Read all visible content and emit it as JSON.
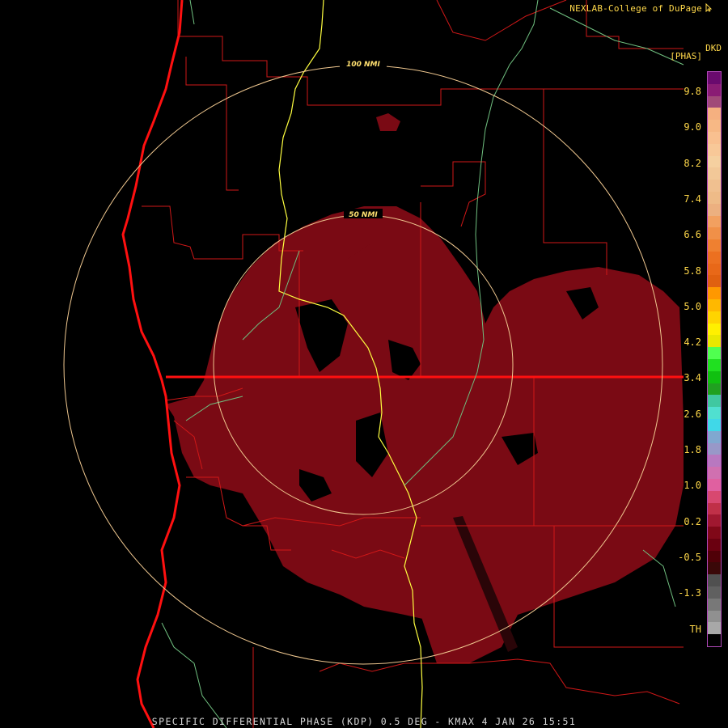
{
  "credit": "NEXLAB-College of DuPage",
  "product_code": "DKD",
  "units": "[PHAS]",
  "footer": "SPECIFIC DIFFERENTIAL PHASE (KDP) 0.5 DEG - KMAX 4 JAN 26 15:51",
  "range_rings": [
    "100 NMI",
    "50 NMI"
  ],
  "colorbar": {
    "ticks": [
      "9.8",
      "9.0",
      "8.2",
      "7.4",
      "6.6",
      "5.8",
      "5.0",
      "4.2",
      "3.4",
      "2.6",
      "1.8",
      "1.0",
      "0.2",
      "-0.5",
      "-1.3",
      "TH"
    ],
    "colors": [
      "#6a0a6e",
      "#8a1c74",
      "#a04a78",
      "#f5b080",
      "#f7b885",
      "#f9c090",
      "#f8c898",
      "#f5d0a0",
      "#f2c898",
      "#f0c090",
      "#eebb88",
      "#ecb080",
      "#f2a060",
      "#f09048",
      "#ef8030",
      "#ec7020",
      "#e86818",
      "#e06010",
      "#ff9800",
      "#ffb800",
      "#ffd400",
      "#fff000",
      "#e8e800",
      "#50ff50",
      "#20e020",
      "#10c010",
      "#20a020",
      "#40c8a0",
      "#50e0d0",
      "#40d8e8",
      "#80a8d0",
      "#9898c8",
      "#b878c0",
      "#d070b0",
      "#e060a0",
      "#d84870",
      "#c03048",
      "#a01830",
      "#800818",
      "#6a0010",
      "#500008",
      "#3a0808",
      "#505050",
      "#606060",
      "#787878",
      "#909090",
      "#a8a8a8",
      "#000000"
    ],
    "rows": 48
  },
  "states_note": "",
  "colors": {
    "echo": "#7a0a14",
    "border": "#e01818",
    "coast": "#ff1010",
    "ring": "#f0c890",
    "highway": "#ffff40",
    "river": "#70c080",
    "label": "#ffd84a"
  }
}
